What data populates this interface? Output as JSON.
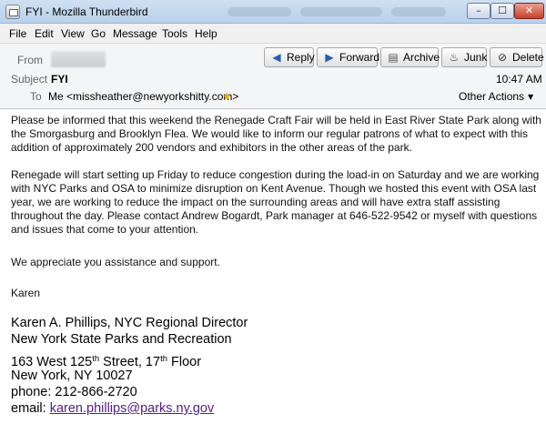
{
  "window": {
    "title": "FYI - Mozilla Thunderbird",
    "controls": {
      "minimize": "–",
      "maximize": "☐",
      "close": "✕"
    }
  },
  "menu": [
    "File",
    "Edit",
    "View",
    "Go",
    "Message",
    "Tools",
    "Help"
  ],
  "header": {
    "from_label": "From",
    "subject_label": "Subject",
    "subject": "FYI",
    "to_label": "To",
    "to": "Me <missheather@newyorkshitty.com>",
    "time": "10:47 AM",
    "other_actions": "Other Actions",
    "buttons": {
      "reply": "Reply",
      "forward": "Forward",
      "archive": "Archive",
      "junk": "Junk",
      "delete": "Delete"
    }
  },
  "body": {
    "p1": [
      "Please be informed that this weekend the Renegade Craft Fair will be held in East River State Park along with",
      "the Smorgasburg and Brooklyn Flea.  We would like to inform our regular patrons of what to expect with this",
      "addition of approximately 200 vendors and exhibitors in the other areas of the park."
    ],
    "p2": [
      "Renegade will start setting up Friday to reduce congestion during the load-in on Saturday and we are working",
      "with NYC Parks and OSA to minimize disruption on Kent Avenue.  Though we hosted this event with OSA last",
      "year, we are working to reduce the impact on the surrounding areas and will have extra staff assisting",
      "throughout the day.  Please contact Andrew Bogardt, Park manager at 646-522-9542 or myself with questions",
      "and issues that come to your attention."
    ],
    "p3": "We appreciate you assistance and support.",
    "p4": "Karen"
  },
  "signature": {
    "name": "Karen A. Phillips, NYC Regional Director",
    "org": "New York State Parks and Recreation",
    "addr_a": "163 West 125",
    "addr_sup1": "th",
    "addr_b": " Street, 17",
    "addr_sup2": "th",
    "addr_c": " Floor",
    "city": "New York, NY  10027",
    "phone": "phone: 212-866-2720",
    "email_label": "email: ",
    "email": "karen.phillips@parks.ny.gov"
  }
}
